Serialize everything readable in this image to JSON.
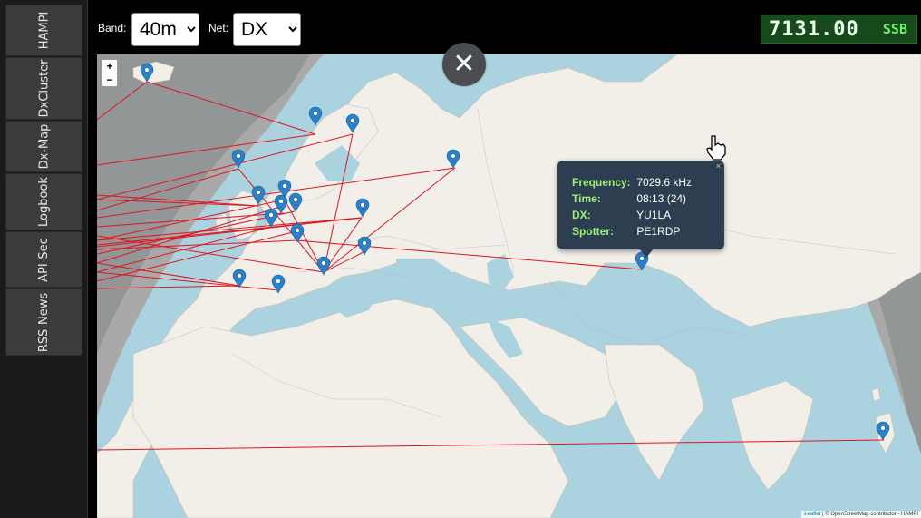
{
  "sidebar": {
    "items": [
      {
        "label": "HAMPI"
      },
      {
        "label": "DxCluster"
      },
      {
        "label": "Dx-Map"
      },
      {
        "label": "Logbook"
      },
      {
        "label": "API-Sec"
      },
      {
        "label": "RSS-News"
      }
    ]
  },
  "toolbar": {
    "band_label": "Band:",
    "band_value": "40m",
    "net_label": "Net:",
    "net_value": "DX"
  },
  "radio": {
    "frequency": "7131.00",
    "mode": "SSB"
  },
  "map": {
    "zoom_in": "+",
    "zoom_out": "−",
    "close_symbol": "✕",
    "attribution_leaflet": "Leaflet",
    "attribution_text": "| © OpenStreetMap contributor - HAMPI",
    "colors": {
      "ocean": "#aad3df",
      "land": "#f2efe9",
      "night_shade": "#808080",
      "spot_line": "#e0141e",
      "marker": "#2a81cb"
    },
    "icons": [
      "map-marker-icon",
      "hand-pointer-icon",
      "close-icon"
    ]
  },
  "popup": {
    "close": "×",
    "frequency_label": "Frequency:",
    "frequency_value": "7029.6 kHz",
    "time_label": "Time:",
    "time_value": "08:13 (24)",
    "dx_label": "DX:",
    "dx_value": "YU1LA",
    "spotter_label": "Spotter:",
    "spotter_value": "PE1RDP"
  }
}
